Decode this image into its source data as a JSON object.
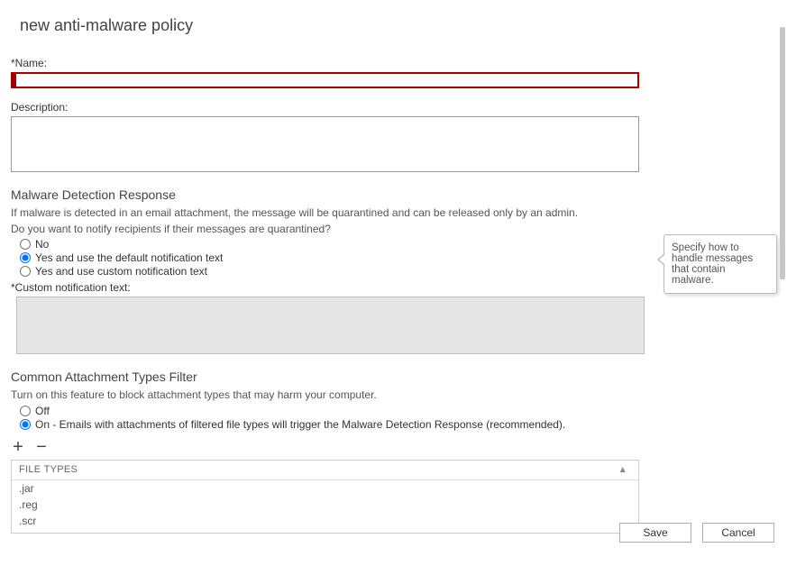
{
  "title": "new anti-malware policy",
  "fields": {
    "name_label": "Name:",
    "name_value": "",
    "desc_label": "Description:",
    "desc_value": ""
  },
  "mdr": {
    "heading": "Malware Detection Response",
    "line1": "If malware is detected in an email attachment, the message will be quarantined and can be released only by an admin.",
    "line2": "Do you want to notify recipients if their messages are quarantined?",
    "opt_no": "No",
    "opt_yes_default": "Yes and use the default notification text",
    "opt_yes_custom": "Yes and use custom notification text",
    "custom_label": "Custom notification text:",
    "custom_value": ""
  },
  "catf": {
    "heading": "Common Attachment Types Filter",
    "desc": "Turn on this feature to block attachment types that may harm your computer.",
    "opt_off": "Off",
    "opt_on": "On - Emails with attachments of filtered file types will trigger the Malware Detection Response (recommended)."
  },
  "filetypes": {
    "header": "FILE TYPES",
    "rows": [
      ".jar",
      ".reg",
      ".scr"
    ]
  },
  "callout": "Specify how to handle messages that contain malware.",
  "buttons": {
    "save": "Save",
    "cancel": "Cancel"
  },
  "icons": {
    "plus": "+",
    "minus": "−",
    "sort": "▲"
  }
}
